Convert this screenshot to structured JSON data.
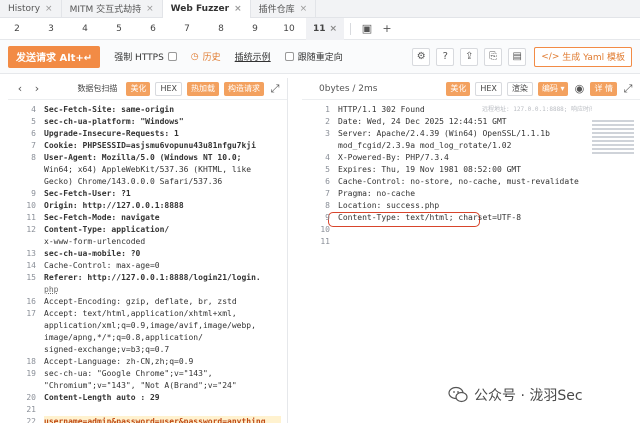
{
  "tabs_top": [
    {
      "label": "History",
      "active": false
    },
    {
      "label": "MITM 交互式劫持",
      "active": false
    },
    {
      "label": "Web Fuzzer",
      "active": true
    },
    {
      "label": "插件仓库",
      "active": false
    }
  ],
  "sub_tabs": [
    "2",
    "3",
    "4",
    "5",
    "6",
    "7",
    "8",
    "9",
    "10",
    "11"
  ],
  "active_sub_tab": "11",
  "toolbar": {
    "send": "发送请求 Alt+↵",
    "https": "强制 HTTPS",
    "history": "历史",
    "examples": "插统示例",
    "redirect": "跟随重定向",
    "yaml": "生成 Yaml 模板"
  },
  "request_panel": {
    "prev": "‹",
    "next": "›",
    "packet_scan": "数据包扫描",
    "beautify": "美化",
    "hex": "HEX",
    "hot_load": "热加载",
    "build_request": "构造请求",
    "lines": [
      {
        "n": "4",
        "text": "Sec-Fetch-Site: same-origin",
        "style": "key"
      },
      {
        "n": "5",
        "text": "sec-ch-ua-platform: \"Windows\"",
        "style": "key"
      },
      {
        "n": "6",
        "text": "Upgrade-Insecure-Requests: 1",
        "style": "key"
      },
      {
        "n": "7",
        "text": "Cookie: PHPSESSID=asjsmu6vopunu43u81nfgu7kji",
        "style": "key"
      },
      {
        "n": "8",
        "text": "User-Agent: Mozilla/5.0 (Windows NT 10.0;",
        "style": "key"
      },
      {
        "n": "",
        "text": "Win64; x64) AppleWebKit/537.36 (KHTML, like",
        "style": "plain"
      },
      {
        "n": "",
        "text": "Gecko) Chrome/143.0.0.0 Safari/537.36",
        "style": "plain"
      },
      {
        "n": "9",
        "text": "Sec-Fetch-User: ?1",
        "style": "key"
      },
      {
        "n": "10",
        "text": "Origin: http://127.0.0.1:8888",
        "style": "key"
      },
      {
        "n": "11",
        "text": "Sec-Fetch-Mode: navigate",
        "style": "key"
      },
      {
        "n": "12",
        "text": "Content-Type: application/",
        "style": "key"
      },
      {
        "n": "",
        "text": "x-www-form-urlencoded",
        "style": "plain"
      },
      {
        "n": "13",
        "text": "sec-ch-ua-mobile: ?0",
        "style": "key"
      },
      {
        "n": "14",
        "text": "Cache-Control: max-age=0",
        "style": "plain"
      },
      {
        "n": "15",
        "text": "Referer: http://127.0.0.1:8888/login21/login.",
        "style": "key"
      },
      {
        "n": "",
        "text": "php",
        "style": "dash"
      },
      {
        "n": "16",
        "text": "Accept-Encoding: gzip, deflate, br, zstd",
        "style": "plain"
      },
      {
        "n": "17",
        "text": "Accept: text/html,application/xhtml+xml,",
        "style": "plain"
      },
      {
        "n": "",
        "text": "application/xml;q=0.9,image/avif,image/webp,",
        "style": "plain"
      },
      {
        "n": "",
        "text": "image/apng,*/*;q=0.8,application/",
        "style": "plain"
      },
      {
        "n": "",
        "text": "signed-exchange;v=b3;q=0.7",
        "style": "plain"
      },
      {
        "n": "18",
        "text": "Accept-Language: zh-CN,zh;q=0.9",
        "style": "plain"
      },
      {
        "n": "19",
        "text": "sec-ch-ua: \"Google Chrome\";v=\"143\",",
        "style": "plain"
      },
      {
        "n": "",
        "text": "\"Chromium\";v=\"143\", \"Not A(Brand\";v=\"24\"",
        "style": "plain"
      },
      {
        "n": "20",
        "text": "Content-Length auto : 29",
        "style": "key"
      },
      {
        "n": "21",
        "text": "",
        "style": "plain"
      },
      {
        "n": "22",
        "text": "username=admin&password=user&password=anything",
        "style": "hl"
      }
    ]
  },
  "response_panel": {
    "size": "0bytes / 2ms",
    "beautify": "美化",
    "hex": "HEX",
    "render": "渲染",
    "encoding": "编码",
    "details": "详 情",
    "lines": [
      {
        "n": "1",
        "text": "HTTP/1.1 302 Found",
        "style": "plain"
      },
      {
        "n": "2",
        "text": "Date: Wed, 24 Dec 2025 12:44:51 GMT",
        "style": "plain"
      },
      {
        "n": "3",
        "text": "Server: Apache/2.4.39 (Win64) OpenSSL/1.1.1b",
        "style": "plain"
      },
      {
        "n": "",
        "text": "mod_fcgid/2.3.9a mod_log_rotate/1.02",
        "style": "plain"
      },
      {
        "n": "4",
        "text": "X-Powered-By: PHP/7.3.4",
        "style": "plain"
      },
      {
        "n": "5",
        "text": "Expires: Thu, 19 Nov 1981 08:52:00 GMT",
        "style": "plain"
      },
      {
        "n": "6",
        "text": "Cache-Control: no-store, no-cache, must-revalidate",
        "style": "plain"
      },
      {
        "n": "7",
        "text": "Pragma: no-cache",
        "style": "plain"
      },
      {
        "n": "8",
        "text": "Location: success.php",
        "style": "plain"
      },
      {
        "n": "9",
        "text": "Content-Type: text/html; charset=UTF-8",
        "style": "plain"
      },
      {
        "n": "10",
        "text": "",
        "style": "plain"
      },
      {
        "n": "11",
        "text": "",
        "style": "plain"
      }
    ],
    "overlay": "远程地址: 127.0.0.1:8888; 响应时间: 2ms; 总耗时: 4ms; URL:htt"
  },
  "watermark": "公众号 · 泷羽Sec"
}
